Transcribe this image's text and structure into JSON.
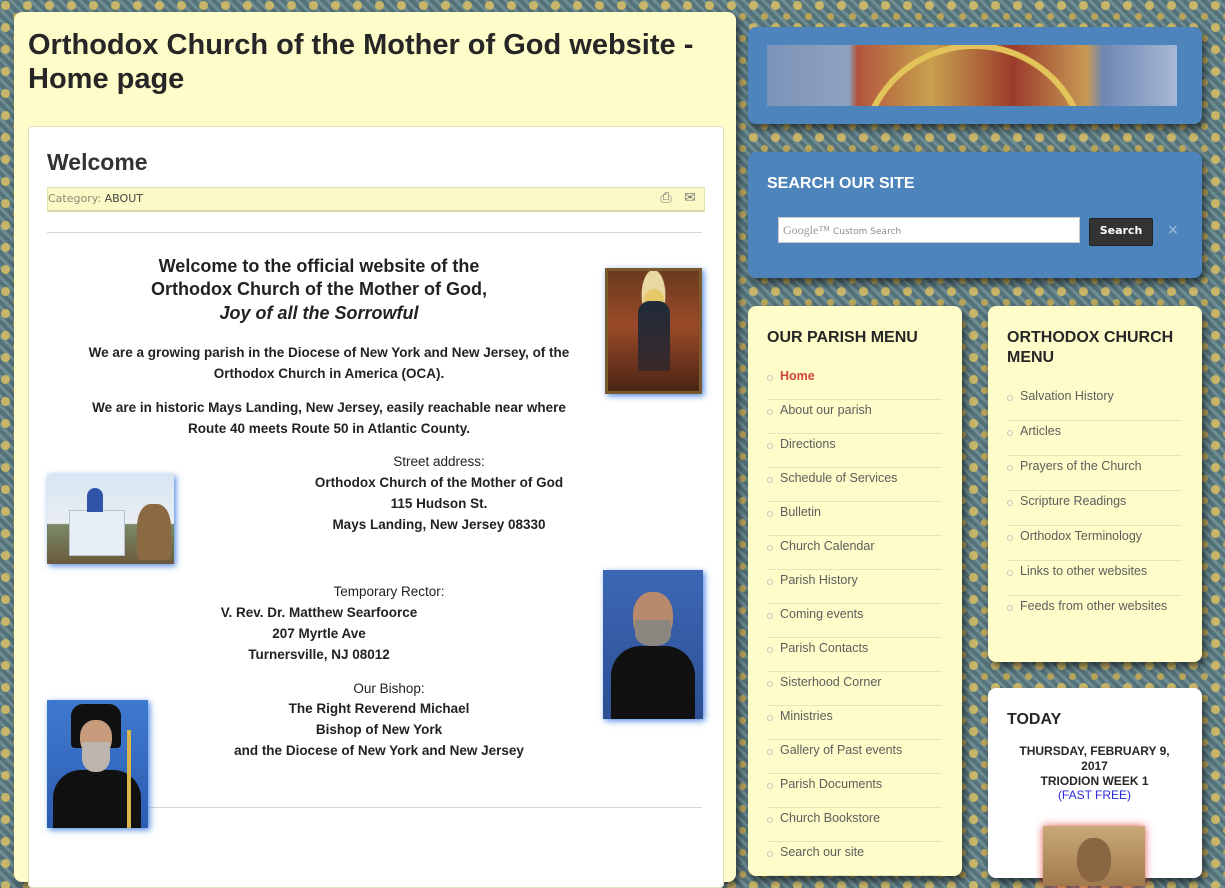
{
  "page": {
    "title": "Orthodox Church of the Mother of God website - Home page"
  },
  "article": {
    "title": "Welcome",
    "category_label": "Category:",
    "category_value": "ABOUT",
    "icons": [
      "print-icon",
      "email-icon"
    ],
    "welcome_line1": "Welcome to the official website of the",
    "welcome_line2": "Orthodox Church of the Mother of God,",
    "welcome_line3": "Joy of all the Sorrowful",
    "para1_line1": "We are a growing parish in the Diocese of New York and New Jersey, of the",
    "para1_line2": "Orthodox Church in America (OCA).",
    "para2_line1": "We are in historic Mays Landing, New Jersey, easily reachable near where",
    "para2_line2": "Route 40 meets Route 50 in Atlantic County.",
    "street_label": "Street address:",
    "street_line1": "Orthodox Church of the Mother of God",
    "street_line2": "115 Hudson St.",
    "street_line3": "Mays Landing, New Jersey 08330",
    "rector_label": "Temporary Rector:",
    "rector_line1": "V. Rev. Dr. Matthew Searfoorce",
    "rector_line2": "207 Myrtle Ave",
    "rector_line3": "Turnersville, NJ 08012",
    "bishop_label": "Our Bishop:",
    "bishop_line1": "The Right Reverend Michael",
    "bishop_line2": "Bishop of New York",
    "bishop_line3": "and the Diocese of New York and New Jersey"
  },
  "search": {
    "title": "SEARCH OUR SITE",
    "google_label": "Google™",
    "placeholder": "Custom Search",
    "button_label": "Search",
    "clear_symbol": "×"
  },
  "parish_menu": {
    "title": "OUR PARISH MENU",
    "items": [
      {
        "label": "Home",
        "active": true
      },
      {
        "label": "About our parish"
      },
      {
        "label": "Directions"
      },
      {
        "label": "Schedule of Services"
      },
      {
        "label": "Bulletin"
      },
      {
        "label": "Church Calendar"
      },
      {
        "label": "Parish History"
      },
      {
        "label": "Coming events"
      },
      {
        "label": "Parish Contacts"
      },
      {
        "label": "Sisterhood Corner"
      },
      {
        "label": "Ministries"
      },
      {
        "label": "Gallery of Past events"
      },
      {
        "label": "Parish Documents"
      },
      {
        "label": "Church Bookstore"
      },
      {
        "label": "Search our site"
      }
    ]
  },
  "church_menu": {
    "title": "ORTHODOX CHURCH MENU",
    "items": [
      {
        "label": "Salvation History"
      },
      {
        "label": "Articles"
      },
      {
        "label": "Prayers of the Church"
      },
      {
        "label": "Scripture Readings"
      },
      {
        "label": "Orthodox Terminology"
      },
      {
        "label": "Links to other websites"
      },
      {
        "label": "Feeds from other websites"
      }
    ]
  },
  "today": {
    "title": "TODAY",
    "date": "THURSDAY, FEBRUARY 9, 2017",
    "week": "TRIODION WEEK 1",
    "fast": "(FAST FREE)"
  },
  "colors": {
    "main_bg": "#fefcc8",
    "side_blue": "#4c84bb",
    "active_link": "#d0443c",
    "fast_link": "#2a2adc"
  }
}
